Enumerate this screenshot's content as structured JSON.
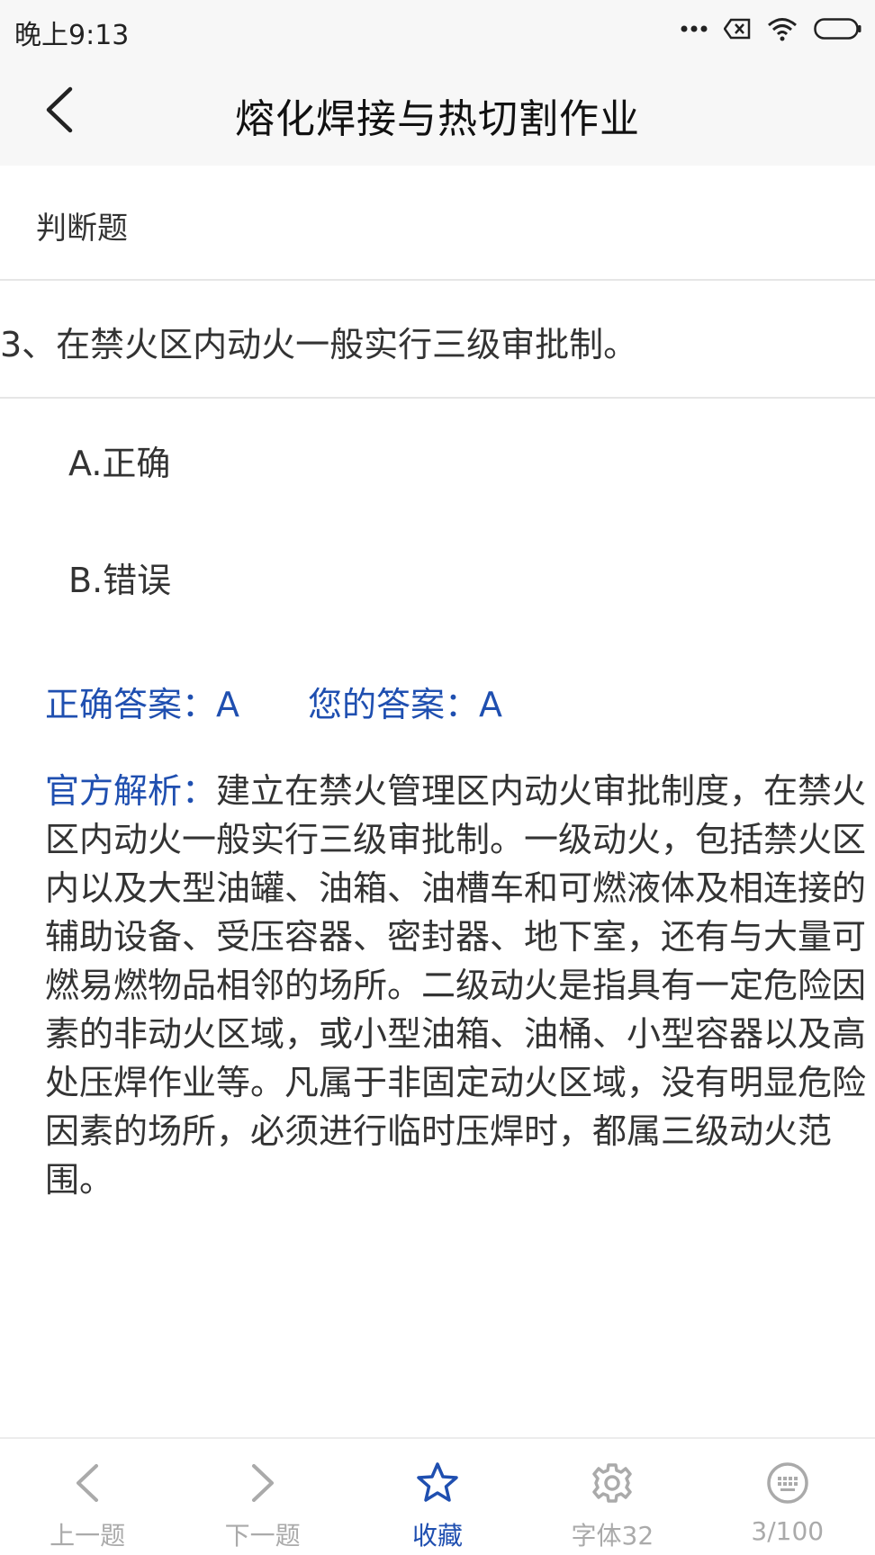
{
  "status_bar": {
    "time": "晚上9:13"
  },
  "header": {
    "title": "熔化焊接与热切割作业"
  },
  "question": {
    "type": "判断题",
    "text": "3、在禁火区内动火一般实行三级审批制。",
    "options": [
      {
        "label": "A.正确"
      },
      {
        "label": "B.错误"
      }
    ]
  },
  "answers": {
    "correct": "正确答案：A",
    "yours": "您的答案：A"
  },
  "analysis": {
    "label": "官方解析：",
    "text": "建立在禁火管理区内动火审批制度，在禁火区内动火一般实行三级审批制。一级动火，包括禁火区内以及大型油罐、油箱、油槽车和可燃液体及相连接的辅助设备、受压容器、密封器、地下室，还有与大量可燃易燃物品相邻的场所。二级动火是指具有一定危险因素的非动火区域，或小型油箱、油桶、小型容器以及高处压焊作业等。凡属于非固定动火区域，没有明显危险因素的场所，必须进行临时压焊时，都属三级动火范围。"
  },
  "bottom_nav": {
    "items": [
      {
        "label": "上一题",
        "icon": "chevron-left-icon"
      },
      {
        "label": "下一题",
        "icon": "chevron-right-icon"
      },
      {
        "label": "收藏",
        "icon": "star-icon"
      },
      {
        "label": "字体32",
        "icon": "gear-icon"
      },
      {
        "label": "3/100",
        "icon": "keyboard-icon"
      }
    ]
  },
  "colors": {
    "accent": "#1f4fb0",
    "header_bg": "#f7f7f7",
    "nav_inactive": "#aaaaaa"
  }
}
